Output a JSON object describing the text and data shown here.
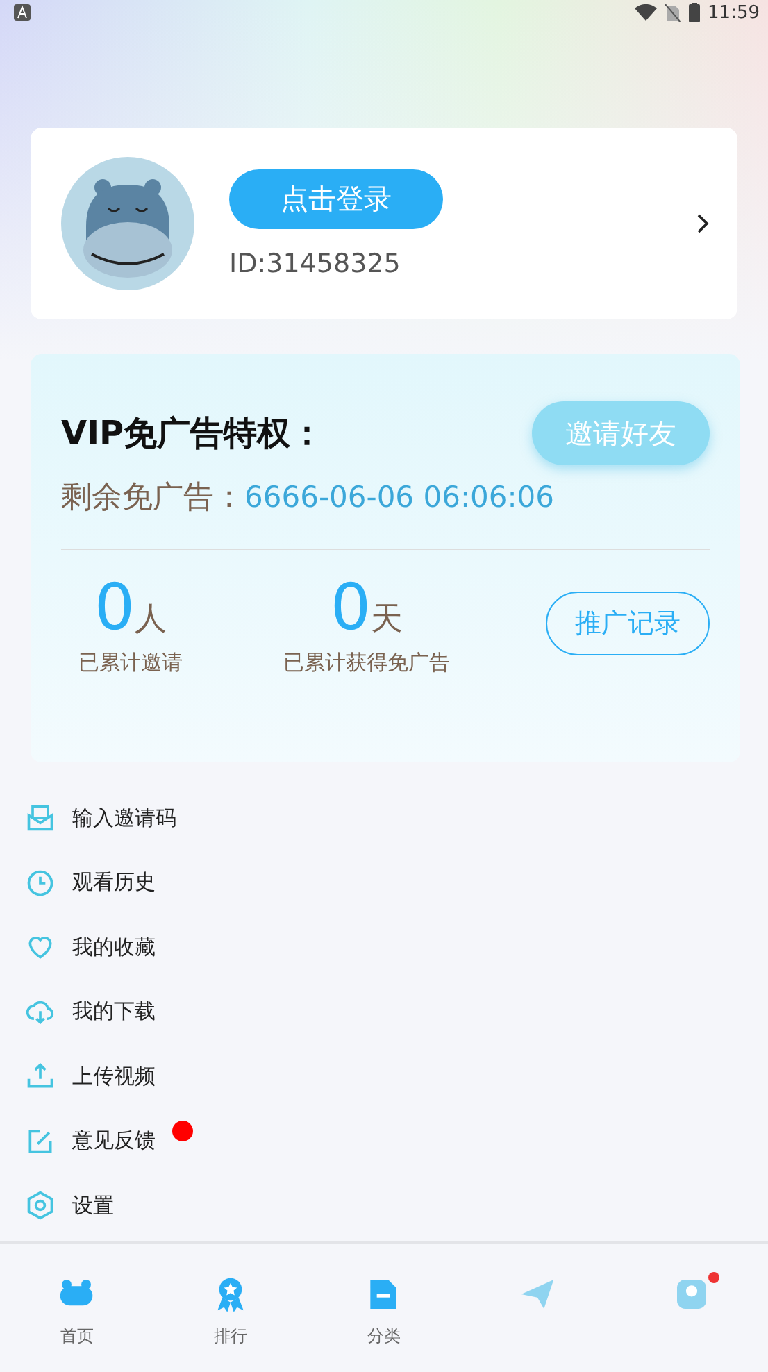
{
  "status_bar": {
    "time": "11:59"
  },
  "profile": {
    "login_button": "点击登录",
    "user_id": "ID:31458325"
  },
  "vip": {
    "title": "VIP免广告特权：",
    "invite_button": "邀请好友",
    "remaining_label": "剩余免广告：",
    "remaining_value": "6666-06-06 06:06:06",
    "stats": [
      {
        "value": "0",
        "unit": "人",
        "label": "已累计邀请"
      },
      {
        "value": "0",
        "unit": "天",
        "label": "已累计获得免广告"
      }
    ],
    "record_button": "推广记录"
  },
  "menu": [
    {
      "kind": "invite",
      "label": "输入邀请码",
      "badge": false
    },
    {
      "kind": "history",
      "label": "观看历史",
      "badge": false
    },
    {
      "kind": "favorite",
      "label": "我的收藏",
      "badge": false
    },
    {
      "kind": "download",
      "label": "我的下载",
      "badge": false
    },
    {
      "kind": "upload",
      "label": "上传视频",
      "badge": false
    },
    {
      "kind": "feedback",
      "label": "意见反馈",
      "badge": true
    },
    {
      "kind": "settings",
      "label": "设置",
      "badge": false
    }
  ],
  "tabs": [
    {
      "kind": "home",
      "label": "首页",
      "badge": false
    },
    {
      "kind": "rank",
      "label": "排行",
      "badge": false
    },
    {
      "kind": "category",
      "label": "分类",
      "badge": false
    },
    {
      "kind": "plane",
      "badge": false
    },
    {
      "kind": "profile",
      "badge": true
    }
  ]
}
